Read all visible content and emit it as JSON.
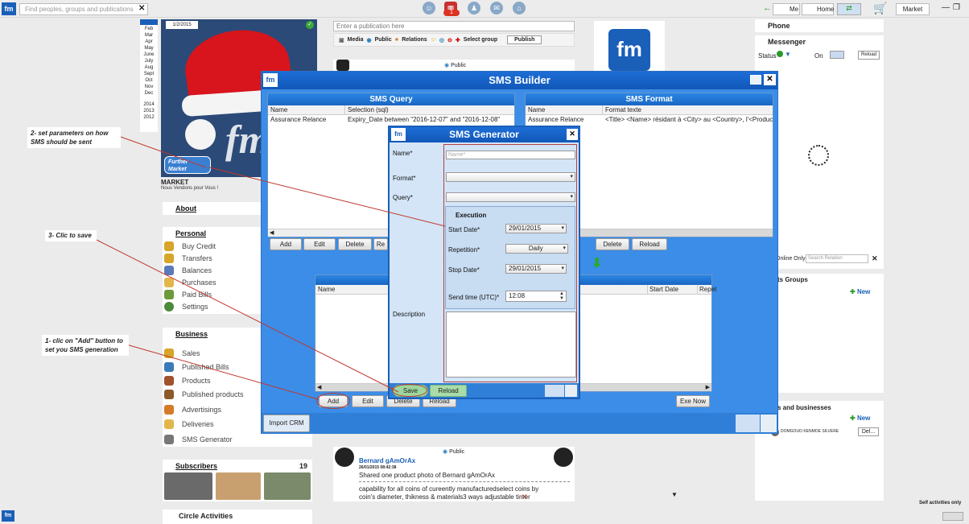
{
  "topbar": {
    "search_placeholder": "Find peoples, groups and publications",
    "notif_count": "1",
    "me": "Me",
    "home": "Home",
    "market": "Market"
  },
  "profile": {
    "date_tag": "1/2/2015",
    "months": [
      "Feb",
      "Mar",
      "Apr",
      "May",
      "June",
      "July",
      "Aug",
      "Sept",
      "Oct",
      "Nov",
      "Dec"
    ],
    "years": [
      "2014",
      "2013",
      "2012"
    ],
    "name": "MARKET",
    "tagline": "Nous Vendons pour Vous !",
    "badge": "Further Market"
  },
  "leftmenu": {
    "about": "About",
    "personal": "Personal",
    "personal_items": [
      "Buy Credit",
      "Transfers",
      "Balances",
      "Purchases",
      "Paid Bills",
      "Settings"
    ],
    "business": "Business",
    "business_items": [
      "Sales",
      "Published Bills",
      "Products",
      "Published products",
      "Advertisings",
      "Deliveries",
      "SMS Generator"
    ],
    "subscribers": "Subscribers",
    "subscribers_count": "19",
    "circle": "Circle Activities"
  },
  "feed": {
    "placeholder": "Enter a publication here",
    "media": "Media",
    "public": "Public",
    "relations": "Relations",
    "select_group": "Select group",
    "publish": "Publish",
    "post_visibility": "Public",
    "post_author": "Bernard gAmOrAx",
    "post_date": "26/01/2015 08:42:38",
    "post_line1": "Shared one product photo of   Bernard gAmOrAx",
    "post_line2": "capability for all coins of cureently manufacturedselect coins by coin's diameter, thikness & materials3 ways adjustable timer switchcar"
  },
  "rightcol": {
    "phone": "Phone",
    "messenger": "Messenger",
    "status": "Status",
    "on": "On",
    "reload": "Reload",
    "online_only": "Online Only",
    "search_relation": "Search Relation",
    "groups": "ts Groups",
    "new": "New",
    "businesses": "s and businesses",
    "biz_person": "DOMGOUO KENMOE SILVERE",
    "del": "Del...",
    "self_activities": "Self activities only"
  },
  "sms_builder": {
    "title": "SMS Builder",
    "query_title": "SMS Query",
    "query_cols": [
      "Name",
      "Selection (sql)"
    ],
    "query_row": [
      "Assurance Relance",
      "Expiry_Date between \"2016-12-07\" and \"2016-12-08\""
    ],
    "format_title": "SMS Format",
    "format_cols": [
      "Name",
      "Format texte"
    ],
    "format_row": [
      "Assurance Relance",
      "<Title>  <Name> résidant à <City> au <Country>, l'<Product_"
    ],
    "add": "Add",
    "edit": "Edit",
    "delete": "Delete",
    "re": "Re",
    "reload": "Reload",
    "gen_cols": [
      "Name",
      "Start Date",
      "Repet"
    ],
    "exe_now": "Exe Now",
    "import_crm": "Import CRM"
  },
  "sms_generator": {
    "title": "SMS Generator",
    "name_label": "Name*",
    "name_placeholder": "Name*",
    "format_label": "Format*",
    "query_label": "Query*",
    "execution": "Execution",
    "start_label": "Start Date*",
    "start_value": "29/01/2015",
    "repetition_label": "Repetition*",
    "repetition_value": "Daily",
    "stop_label": "Stop Date*",
    "stop_value": "29/01/2015",
    "send_label": "Send time (UTC)*",
    "send_value": "12:08",
    "description_label": "Description",
    "save": "Save",
    "reload": "Reload"
  },
  "annotations": {
    "step2": "2-   set parameters on how SMS should be sent",
    "step3": "3- Clic to save",
    "step1": "1-  clic on \"Add\" button to set you SMS generation"
  },
  "colors": {
    "accent": "#1e6ed6",
    "window": "#3b8de8",
    "annotation_line": "#c0392b"
  }
}
